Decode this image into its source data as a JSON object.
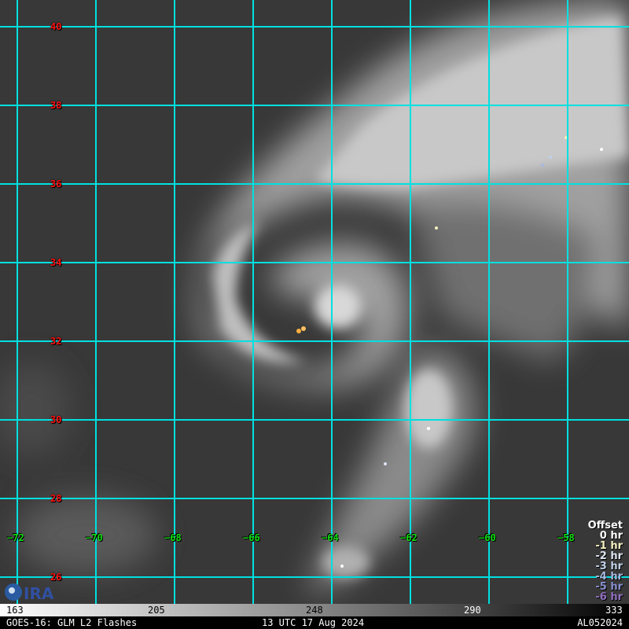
{
  "map": {
    "latitudes": [
      "40",
      "38",
      "36",
      "34",
      "32",
      "30",
      "28",
      "26"
    ],
    "longitudes": [
      "−72",
      "−70",
      "−68",
      "−66",
      "−64",
      "−62",
      "−60",
      "−58"
    ],
    "grid_color": "#00e0e0",
    "lat_label_color": "#ff1010",
    "lon_label_color": "#10e010"
  },
  "legend": {
    "title": "Offset",
    "items": [
      {
        "label": "0 hr",
        "color": "#ffffff"
      },
      {
        "label": "-1 hr",
        "color": "#f4f0c0"
      },
      {
        "label": "-2 hr",
        "color": "#dde4f0"
      },
      {
        "label": "-3 hr",
        "color": "#c0d0e8"
      },
      {
        "label": "-4 hr",
        "color": "#a8b8e0"
      },
      {
        "label": "-5 hr",
        "color": "#8890d0"
      },
      {
        "label": "-6 hr",
        "color": "#9070c0"
      }
    ]
  },
  "colorbar": {
    "ticks": [
      "163",
      "205",
      "248",
      "290",
      "333"
    ]
  },
  "footer": {
    "product": "GOES-16: GLM L2 Flashes",
    "time": "13 UTC 17 Aug 2024",
    "storm_id": "AL052024"
  },
  "logo": {
    "text": "CIRA"
  }
}
